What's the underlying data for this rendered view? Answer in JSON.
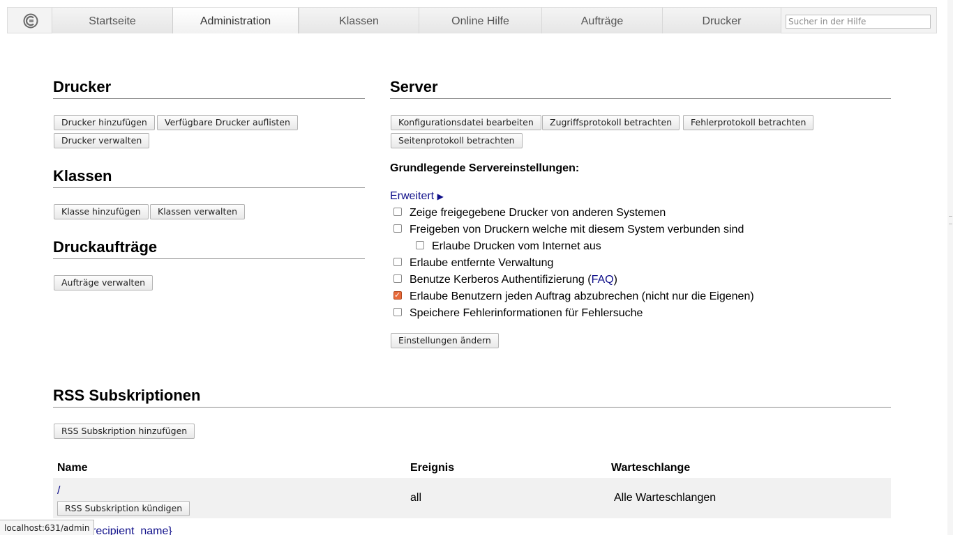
{
  "nav": {
    "tabs": [
      "Startseite",
      "Administration",
      "Klassen",
      "Online Hilfe",
      "Aufträge",
      "Drucker"
    ],
    "active": "Administration",
    "search_placeholder": "Sucher in der Hilfe"
  },
  "drucker": {
    "title": "Drucker",
    "buttons": [
      "Drucker hinzufügen",
      "Verfügbare Drucker auflisten",
      "Drucker verwalten"
    ]
  },
  "klassen": {
    "title": "Klassen",
    "buttons": [
      "Klasse hinzufügen",
      "Klassen verwalten"
    ]
  },
  "auftraege": {
    "title": "Druckaufträge",
    "buttons": [
      "Aufträge verwalten"
    ]
  },
  "server": {
    "title": "Server",
    "buttons": [
      "Konfigurationsdatei bearbeiten",
      "Zugriffsprotokoll betrachten",
      "Fehlerprotokoll betrachten",
      "Seitenprotokoll betrachten"
    ],
    "settings_heading": "Grundlegende Servereinstellungen:",
    "advanced_link": "Erweitert",
    "advanced_arrow": "▶",
    "checkboxes": [
      {
        "label": "Zeige freigegebene Drucker von anderen Systemen",
        "checked": false
      },
      {
        "label": "Freigeben von Druckern welche mit diesem System verbunden sind",
        "checked": false
      },
      {
        "label": "Erlaube Drucken vom Internet aus",
        "checked": false
      },
      {
        "label": "Erlaube entfernte Verwaltung",
        "checked": false
      },
      {
        "label": "Benutze Kerberos Authentifizierung (",
        "checked": false,
        "link": "FAQ",
        "suffix": ")"
      },
      {
        "label": "Erlaube Benutzern jeden Auftrag abzubrechen (nicht nur die Eigenen)",
        "checked": true
      },
      {
        "label": "Speichere Fehlerinformationen für Fehlersuche",
        "checked": false
      }
    ],
    "apply_button": "Einstellungen ändern"
  },
  "rss": {
    "title": "RSS Subskriptionen",
    "add_button": "RSS Subskription hinzufügen",
    "columns": [
      "Name",
      "Ereignis",
      "Warteschlange"
    ],
    "rows": [
      {
        "name": "/",
        "cancel_button": "RSS Subskription kündigen",
        "event": "all",
        "queue": "Alle Warteschlangen"
      }
    ],
    "partial_row": "recipient_name}"
  },
  "statusbar": "localhost:631/admin"
}
